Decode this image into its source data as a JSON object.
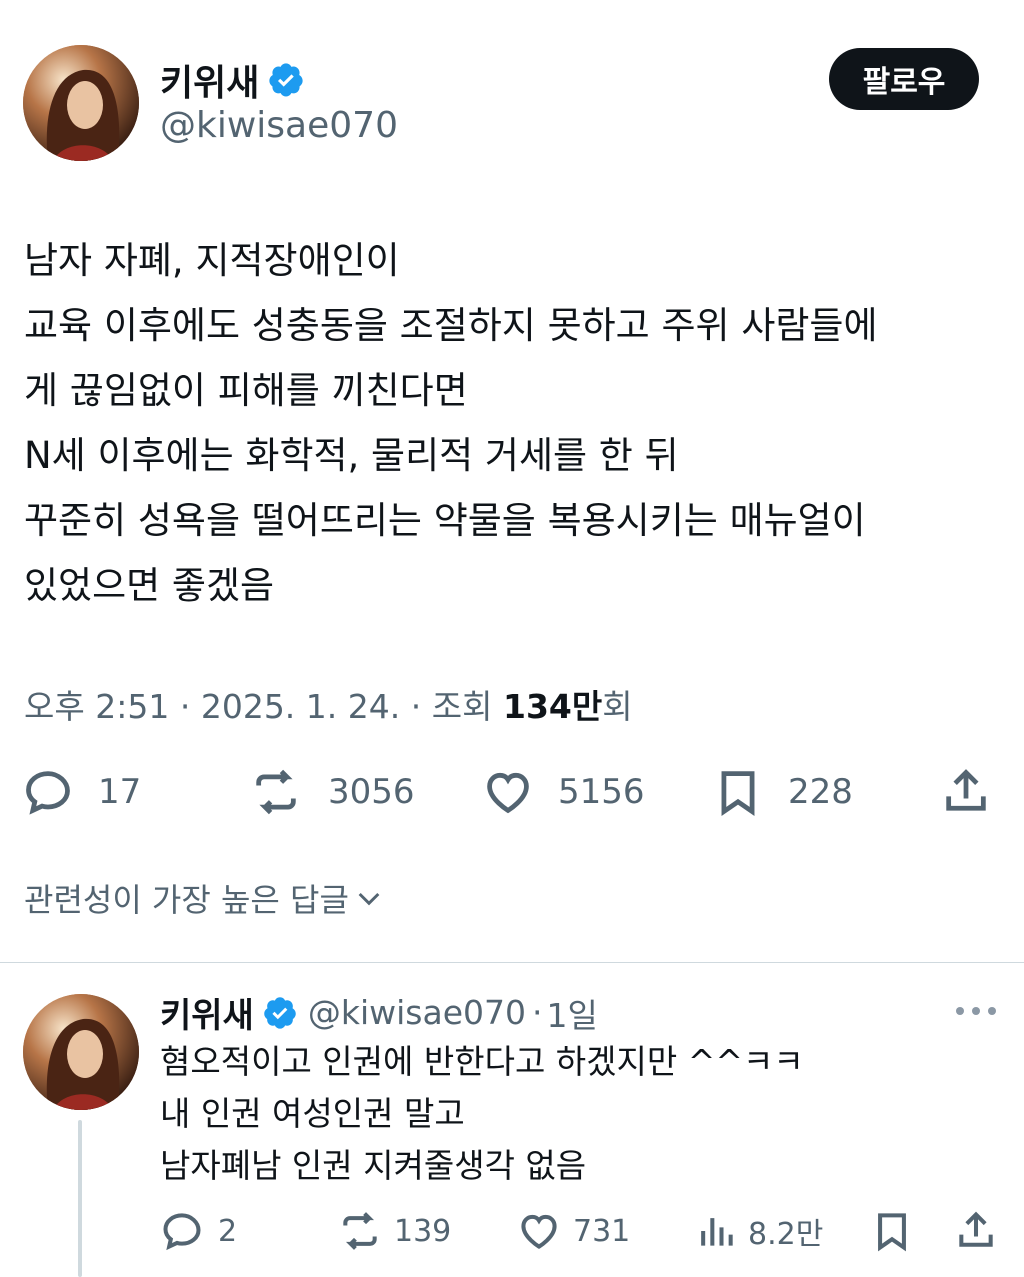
{
  "tweet": {
    "author_name": "키위새",
    "author_handle": "@kiwisae070",
    "follow_label": "팔로우",
    "text_lines": [
      "남자 자폐, 지적장애인이",
      "교육 이후에도 성충동을 조절하지 못하고 주위 사람들에",
      "게 끊임없이 피해를 끼친다면",
      "N세 이후에는 화학적, 물리적 거세를 한 뒤",
      "꾸준히 성욕을 떨어뜨리는 약물을 복용시키는 매뉴얼이",
      "있었으면 좋겠음"
    ],
    "time": "오후 2:51",
    "date": "2025. 1. 24.",
    "views_label": "조회",
    "views_count": "134만",
    "views_suffix": "회",
    "separator": "·",
    "replies": "17",
    "retweets": "3056",
    "likes": "5156",
    "bookmarks": "228"
  },
  "sort": {
    "label": "관련성이 가장 높은 답글"
  },
  "reply": {
    "author_name": "키위새",
    "author_handle": "@kiwisae070",
    "separator": "·",
    "time": "1일",
    "text_lines": [
      "혐오적이고 인권에 반한다고 하겠지만 ^^ㅋㅋ",
      "내 인권 여성인권 말고",
      "남자폐남 인권 지켜줄생각 없음"
    ],
    "replies": "2",
    "retweets": "139",
    "likes": "731",
    "views": "8.2만"
  },
  "icons": {
    "verified": "verified-badge-icon",
    "reply": "reply-icon",
    "retweet": "retweet-icon",
    "like": "heart-icon",
    "bookmark": "bookmark-icon",
    "share": "share-icon",
    "views": "views-chart-icon",
    "more": "more-icon",
    "chevron": "chevron-down-icon"
  },
  "colors": {
    "verified": "#1d9bf0",
    "text": "#0f1419",
    "secondary": "#536471",
    "follow_bg": "#0f1419"
  }
}
